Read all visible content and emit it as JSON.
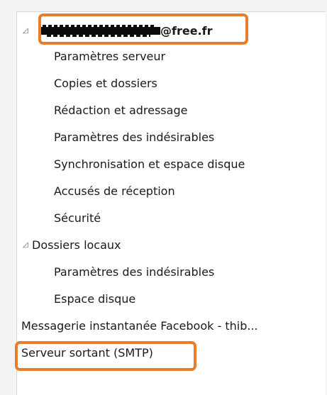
{
  "account": {
    "email_suffix": "@free.fr",
    "expander_glyph": "◿",
    "items": [
      "Paramètres serveur",
      "Copies et dossiers",
      "Rédaction et adressage",
      "Paramètres des indésirables",
      "Synchronisation et espace disque",
      "Accusés de réception",
      "Sécurité"
    ]
  },
  "local_folders": {
    "label": "Dossiers locaux",
    "expander_glyph": "◿",
    "items": [
      "Paramètres des indésirables",
      "Espace disque"
    ]
  },
  "facebook_chat": {
    "label": "Messagerie instantanée Facebook - thib..."
  },
  "smtp": {
    "label": "Serveur sortant (SMTP)"
  },
  "colors": {
    "highlight": "#ea7d2c",
    "panel_background": "#ffffff",
    "outer_background": "#f3f3f3"
  }
}
